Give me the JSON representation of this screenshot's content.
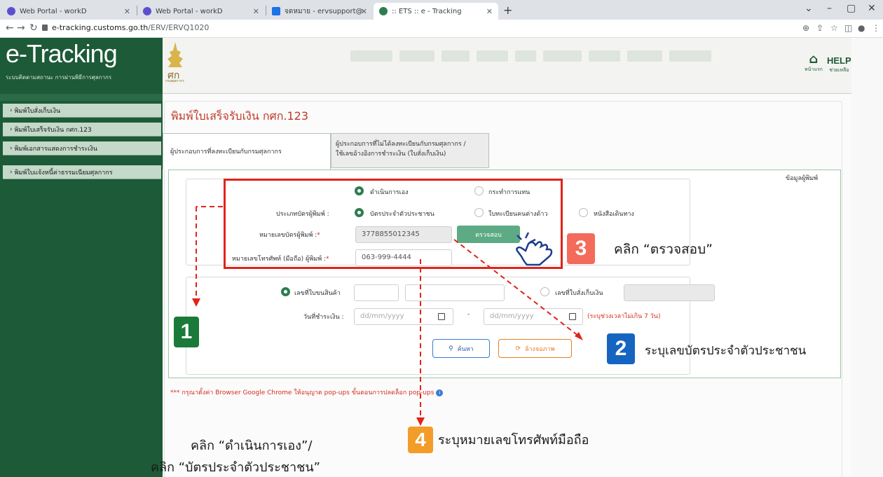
{
  "browser": {
    "tabs": [
      {
        "label": "Web Portal - workD",
        "active": false,
        "favicon_color": "#5b4fcf"
      },
      {
        "label": "Web Portal - workD",
        "active": false,
        "favicon_color": "#5b4fcf"
      },
      {
        "label": "จดหมาย - ervsupport@customs.g",
        "active": false,
        "favicon_color": "#1a73e8"
      },
      {
        "label": ":: ETS :: e - Tracking",
        "active": true,
        "favicon_color": "#2e7d4f"
      }
    ],
    "new_tab": "+",
    "url_host": "e-tracking.customs.go.th",
    "url_path": "/ERV/ERVQ1020"
  },
  "header": {
    "brand_title": "e-Tracking",
    "brand_subtitle": "ระบบติดตามสถานะ การผ่านพิธีการศุลกากร",
    "crest_caption": "กรมศุลกากร",
    "home_label": "หน้าแรก",
    "help_title": "HELP",
    "help_label": "ช่วยเหลือ"
  },
  "sidebar": {
    "items": [
      {
        "label": "พิมพ์ใบสั่งเก็บเงิน"
      },
      {
        "label": "พิมพ์ใบเสร็จรับเงิน กศก.123"
      },
      {
        "label": "พิมพ์เอกสารแสดงการชำระเงิน"
      },
      {
        "label": "พิมพ์ใบแจ้งหนี้ค่าธรรมเนียมศุลกากร"
      }
    ]
  },
  "main": {
    "title": "พิมพ์ใบเสร็จรับเงิน กศก.123",
    "tab_registered": "ผู้ประกอบการที่ลงทะเบียนกับกรมศุลกากร",
    "tab_unregistered_line1": "ผู้ประกอบการที่ไม่ได้ลงทะเบียนกับกรมศุลกากร /",
    "tab_unregistered_line2": "ใช้เลขอ้างอิงการชำระเงิน (ใบสั่งเก็บเงิน)",
    "printer_info_legend": "ข้อมูลผู้พิมพ์",
    "radio_self": "ดำเนินการเอง",
    "radio_proxy": "กระทำการแทน",
    "card_type_label": "ประเภทบัตรผู้พิมพ์ :",
    "card_national_id": "บัตรประจำตัวประชาชน",
    "card_alien": "ใบทะเบียนคนต่างด้าว",
    "card_passport": "หนังสือเดินทาง",
    "card_no_label": "หมายเลขบัตรผู้พิมพ์ :",
    "card_no_value": "3778855012345",
    "check_button": "ตรวจสอบ",
    "phone_label": "หมายเลขโทรศัพท์ (มือถือ) ผู้พิมพ์ :",
    "phone_value": "063-999-4444",
    "required_mark": "*",
    "radio_cargo": "เลขที่ใบขนสินค้า",
    "radio_payment_order": "เลขที่ใบสั่งเก็บเงิน",
    "pay_date_label": "วันที่ชำระเงิน :",
    "date_placeholder": "dd/mm/yyyy",
    "date_separator": "-",
    "date_hint": "(ระบุช่วงเวลาไม่เกิน 7 วัน)",
    "search_button": "ค้นหา",
    "clear_button": "ล้างจอภาพ",
    "popup_note": "*** กรุณาตั้งค่า Browser Google Chrome ให้อนุญาต pop-ups ขั้นตอนการปลดล็อก pop-ups"
  },
  "annotations": {
    "step1_number": "1",
    "step2_number": "2",
    "step3_number": "3",
    "step4_number": "4",
    "step1_text_line1": "คลิก “ดำเนินการเอง”/",
    "step1_text_line2": "คลิก “บัตรประจำตัวประชาชน”",
    "step2_text": "ระบุเลขบัตรประจำตัวประชาชน",
    "step3_text": "คลิก “ตรวจสอบ”",
    "step4_text": "ระบุหมายเลขโทรศัพท์มือถือ",
    "colors": {
      "step1": "#1b7a3a",
      "step2": "#1565c0",
      "step3": "#f26b5b",
      "step4": "#f39c28",
      "highlight": "#e1231a"
    }
  }
}
